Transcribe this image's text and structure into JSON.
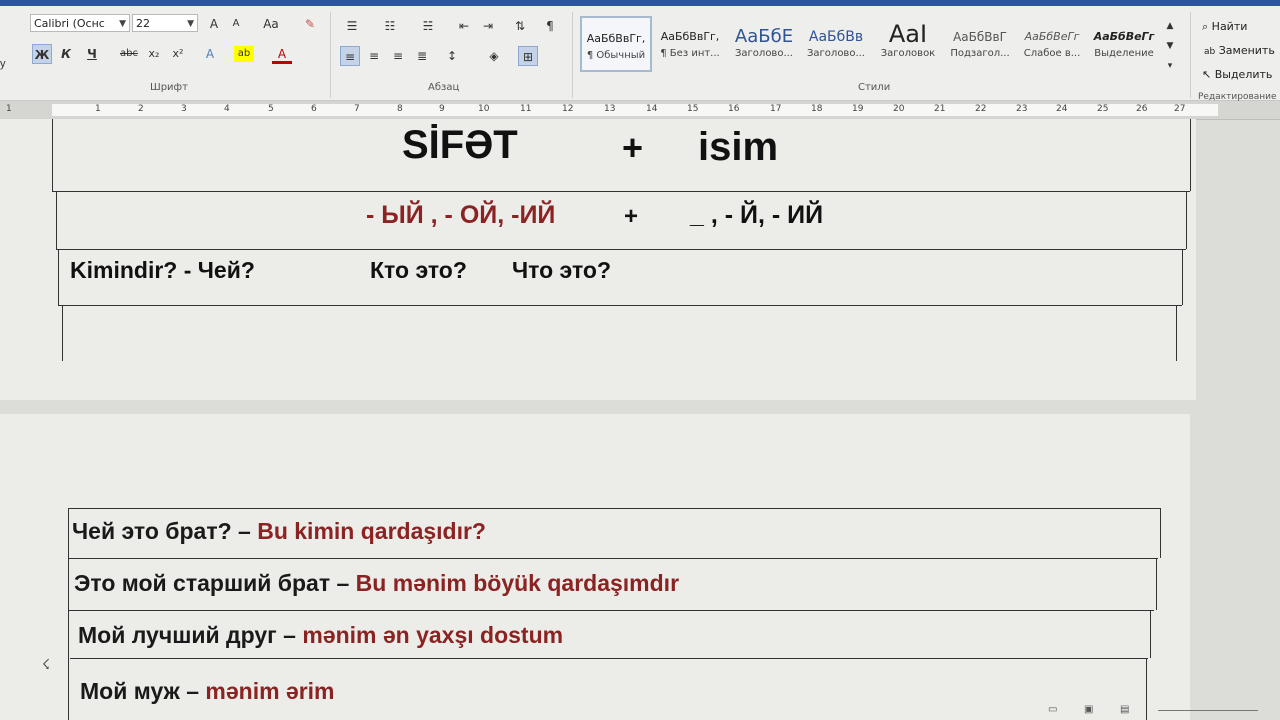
{
  "ribbon": {
    "font_name": "Calibri (Оснс",
    "font_size": "22",
    "grow_font": "A",
    "shrink_font": "A",
    "change_case": "Aa",
    "bold": "Ж",
    "italic": "К",
    "underline": "Ч",
    "strikethrough": "abc",
    "subscript": "x₂",
    "superscript": "x²",
    "text_effects": "A",
    "highlight": "ab",
    "font_color": "A",
    "group_font": "Шрифт",
    "group_paragraph": "Абзац",
    "group_styles": "Стили",
    "group_editing": "Редактирование",
    "left_edge": "у",
    "styles": [
      {
        "preview": "АаБбВвГг,",
        "name": "¶ Обычный"
      },
      {
        "preview": "АаБбВвГг,",
        "name": "¶ Без инт..."
      },
      {
        "preview": "АаБбЕ",
        "name": "Заголово..."
      },
      {
        "preview": "АаБбВв",
        "name": "Заголово..."
      },
      {
        "preview": "AaI",
        "name": "Заголовок"
      },
      {
        "preview": "АаБбВвГ",
        "name": "Подзагол..."
      },
      {
        "preview": "АаБбВеГг",
        "name": "Слабое в..."
      },
      {
        "preview": "АаБбВеГг",
        "name": "Выделение"
      }
    ],
    "editing": {
      "find": "Найти",
      "replace": "Заменить",
      "select": "Выделить"
    }
  },
  "ruler": {
    "numbers": [
      "1",
      "1",
      "2",
      "3",
      "4",
      "5",
      "6",
      "7",
      "8",
      "9",
      "10",
      "11",
      "12",
      "13",
      "14",
      "15",
      "16",
      "17",
      "18",
      "19",
      "20",
      "21",
      "22",
      "23",
      "24",
      "25",
      "26",
      "27"
    ]
  },
  "page1": {
    "title_left": "SİFƏT",
    "title_plus": "+",
    "title_right": "isim",
    "endings_left": "- ЫЙ , - ОЙ,  -ИЙ",
    "endings_plus": "+",
    "endings_right": "_ , - Й,  - ИЙ",
    "q_az": "Kimindir? -  Чей?",
    "q_ru1": "Кто это?",
    "q_ru2": "Что это?"
  },
  "page2": {
    "rows": [
      {
        "ru": "Чей это брат? – ",
        "az": "Bu kimin qardaşıdır?"
      },
      {
        "ru": "Это мой старший брат – ",
        "az": "Bu mənim böyük qardaşımdır"
      },
      {
        "ru": "Мой лучший друг – ",
        "az": "mənim ən yaxşı dostum"
      },
      {
        "ru": "Мой муж – ",
        "az": "mənim ərim"
      }
    ]
  },
  "colors": {
    "accent": "#2b579a",
    "translation": "#8b2323"
  }
}
